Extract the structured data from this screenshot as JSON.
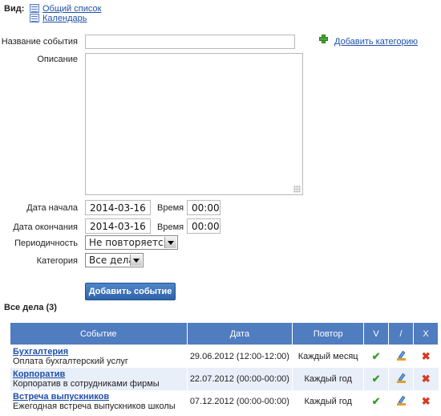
{
  "view": {
    "label": "Вид:",
    "options": [
      "Общий список",
      "Календарь"
    ]
  },
  "form": {
    "name_label": "Название события",
    "name_value": "",
    "add_category_label": "Добавить категорию",
    "description_label": "Описание",
    "description_value": "",
    "start_label": "Дата начала",
    "start_date": "2014-03-16",
    "start_time_label": "Время",
    "start_time": "00:00",
    "end_label": "Дата окончания",
    "end_date": "2014-03-16",
    "end_time_label": "Время",
    "end_time": "00:00",
    "periodicity_label": "Периодичность",
    "periodicity_value": "Не повторяется",
    "category_label": "Категория",
    "category_value": "Все дела",
    "submit_label": "Добавить событие"
  },
  "list": {
    "title": "Все дела (3)",
    "columns": [
      "Событие",
      "Дата",
      "Повтор",
      "V",
      "/",
      "X"
    ],
    "rows": [
      {
        "title": "Бухгалтерия",
        "desc": "Оплата бухгалтерский услуг",
        "date": "29.06.2012 (12:00-12:00)",
        "repeat": "Каждый месяц"
      },
      {
        "title": "Корпоратив",
        "desc": "Корпоратив в сотрудниками фирмы",
        "date": "22.07.2012 (00:00-00:00)",
        "repeat": "Каждый год"
      },
      {
        "title": "Встреча выпускников",
        "desc": "Ежегодная встреча выпускников школы",
        "date": "07.12.2012 (00:00-00:00)",
        "repeat": "Каждый год"
      }
    ]
  },
  "icons": {
    "done": "check-icon",
    "edit": "edit-icon",
    "delete": "delete-icon",
    "list_view": "list-view-icon",
    "calendar_view": "calendar-view-icon",
    "add_category": "plus-icon"
  },
  "colors": {
    "accent": "#507cc0",
    "link": "#1f4fa8",
    "button": "#3a6fb8",
    "row_alt": "#e9eff9"
  }
}
